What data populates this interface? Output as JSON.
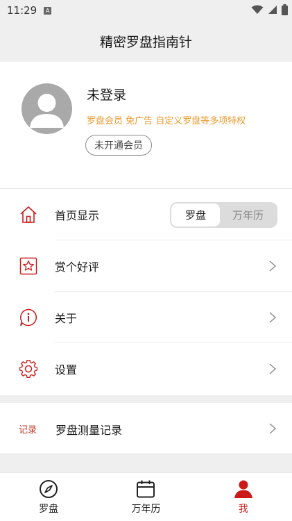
{
  "status_bar": {
    "time": "11:29",
    "notif_icon": "a-notification-icon"
  },
  "header": {
    "title": "精密罗盘指南针"
  },
  "profile": {
    "name": "未登录",
    "description": "罗盘会员 免广告 自定义罗盘等多项特权",
    "vip_button": "未开通会员"
  },
  "settings": {
    "home_display": {
      "label": "首页显示",
      "options": [
        "罗盘",
        "万年历"
      ],
      "selected": "罗盘"
    },
    "rate": {
      "label": "赏个好评"
    },
    "about": {
      "label": "关于"
    },
    "settings": {
      "label": "设置"
    }
  },
  "records": {
    "tag": "记录",
    "label": "罗盘测量记录"
  },
  "bottom_nav": {
    "items": [
      {
        "label": "罗盘",
        "icon": "compass-icon"
      },
      {
        "label": "万年历",
        "icon": "calendar-icon"
      },
      {
        "label": "我",
        "icon": "user-icon"
      }
    ],
    "active": "我"
  },
  "colors": {
    "accent_red": "#cc1a1a",
    "gold": "#e99a2c",
    "background": "#efefef"
  }
}
